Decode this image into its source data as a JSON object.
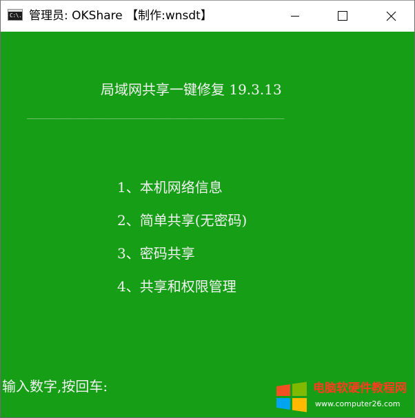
{
  "window": {
    "title": "管理员:  OKShare 【制作:wnsdt】",
    "icon": "console-icon",
    "icon_text": "C:\\.",
    "controls": [
      "minimize-icon",
      "maximize-icon",
      "close-icon"
    ]
  },
  "console": {
    "background": "#169f16",
    "text_color": "#f2f2f2",
    "banner": "局域网共享一键修复 19.3.13",
    "divider": "______________________________________________________________",
    "menu": [
      "1、本机网络信息",
      "2、简单共享(无密码)",
      "3、密码共享",
      "4、共享和权限管理"
    ],
    "prompt": "输入数字,按回车:"
  },
  "watermark": {
    "title": "电脑软硬件教程网",
    "url": "www.computer26.com",
    "logo": "windows-logo-icon",
    "colors": [
      "#f25022",
      "#7fba00",
      "#00a4ef",
      "#ffb900"
    ]
  }
}
